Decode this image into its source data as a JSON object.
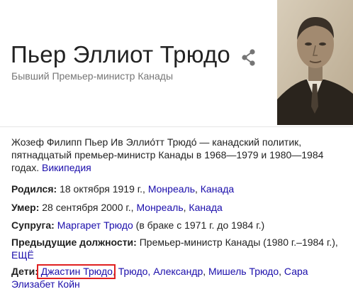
{
  "header": {
    "title": "Пьер Эллиот Трюдо",
    "subtitle": "Бывший Премьер-министр Канады",
    "share_icon": "share-icon",
    "photo_icon": "portrait-photo"
  },
  "description": {
    "text": "Жозеф Филипп Пьер Ив Эллио́тт Трюдо́ — канадский политик, пятнадцатый премьер-министр Канады в 1968—1979 и 1980—1984 годах.",
    "source_link": "Википедия"
  },
  "facts": {
    "born": {
      "label": "Родился:",
      "value": "18 октября 1919 г.,",
      "link1": "Монреаль",
      "sep": ",",
      "link2": "Канада"
    },
    "died": {
      "label": "Умер:",
      "value": "28 сентября 2000 г.,",
      "link1": "Монреаль",
      "sep": ",",
      "link2": "Канада"
    },
    "spouse": {
      "label": "Супруга:",
      "link": "Маргарет Трюдо",
      "value": "(в браке с 1971 г. до 1984 г.)"
    },
    "positions": {
      "label": "Предыдущие должности:",
      "value": "Премьер-министр Канады (1980 г.–1984 г.),",
      "more_link": "ЕЩЁ"
    },
    "children": {
      "label": "Дети:",
      "items": [
        "Джастин Трюдо",
        "Трюдо, Александр",
        "Мишель Трюдо",
        "Сара Элизабет Койн"
      ],
      "sep": ","
    }
  },
  "colors": {
    "link": "#1a0dab",
    "highlight": "#e02020",
    "subtitle": "#777777"
  }
}
